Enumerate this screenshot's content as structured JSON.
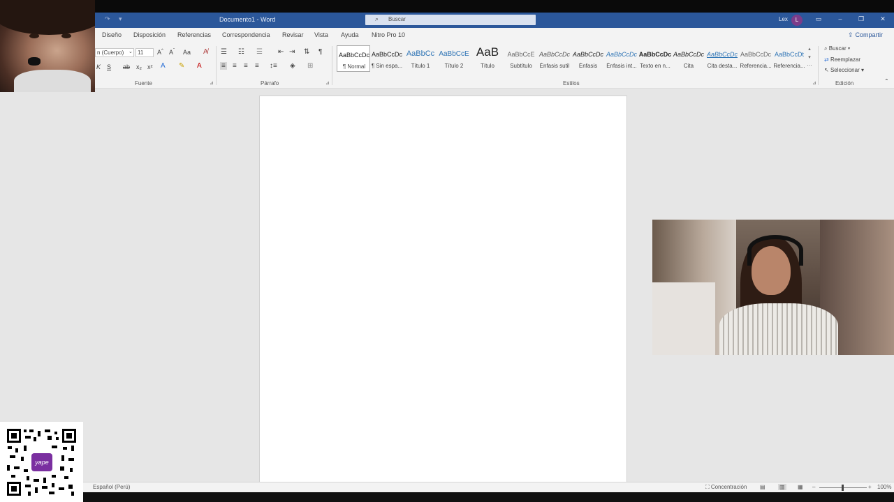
{
  "window": {
    "title": "Documento1 - Word",
    "search_placeholder": "Buscar",
    "user_name": "Lex",
    "user_initial": "L",
    "accent": "#2b579a"
  },
  "tabs": [
    "Diseño",
    "Disposición",
    "Referencias",
    "Correspondencia",
    "Revisar",
    "Vista",
    "Ayuda",
    "Nitro Pro 10"
  ],
  "share_label": "Compartir",
  "font": {
    "name": "n (Cuerpo)",
    "size": "11",
    "grow": "A^",
    "shrink": "Aˇ",
    "case": "Aa",
    "strike": "ab",
    "sub": "x₂",
    "sup": "x²",
    "italic": "K",
    "underline": "S",
    "group_label": "Fuente"
  },
  "paragraph": {
    "group_label": "Párrafo"
  },
  "styles": {
    "group_label": "Estilos",
    "items": [
      {
        "sample": "AaBbCcDc",
        "name": "¶ Normal"
      },
      {
        "sample": "AaBbCcDc",
        "name": "¶ Sin espa..."
      },
      {
        "sample": "AaBbCc",
        "name": "Título 1"
      },
      {
        "sample": "AaBbCcE",
        "name": "Título 2"
      },
      {
        "sample": "AaB",
        "name": "Título"
      },
      {
        "sample": "AaBbCcE",
        "name": "Subtítulo"
      },
      {
        "sample": "AaBbCcDc",
        "name": "Énfasis sutil"
      },
      {
        "sample": "AaBbCcDc",
        "name": "Énfasis"
      },
      {
        "sample": "AaBbCcDc",
        "name": "Énfasis int..."
      },
      {
        "sample": "AaBbCcDc",
        "name": "Texto en n..."
      },
      {
        "sample": "AaBbCcDc",
        "name": "Cita"
      },
      {
        "sample": "AaBbCcDc",
        "name": "Cita desta..."
      },
      {
        "sample": "AaBbCcDc",
        "name": "Referencia..."
      },
      {
        "sample": "AaBbCcDt",
        "name": "Referencia..."
      }
    ]
  },
  "editing": {
    "group_label": "Edición",
    "find": "Buscar",
    "replace": "Reemplazar",
    "select": "Seleccionar"
  },
  "status": {
    "language": "Español (Perú)",
    "focus": "Concentración",
    "zoom": "100%"
  },
  "qr_badge": "yape"
}
